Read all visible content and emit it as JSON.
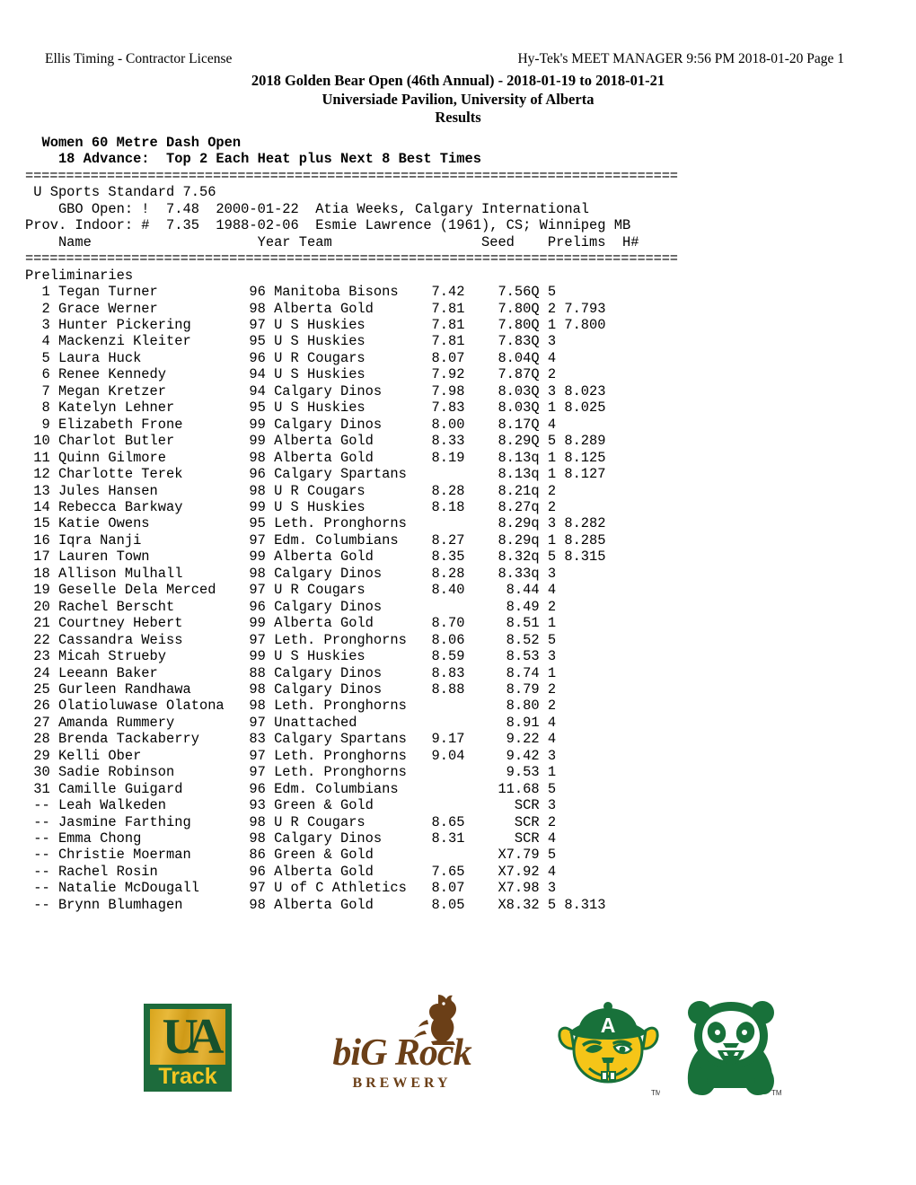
{
  "header": {
    "left": "Ellis Timing - Contractor License",
    "right": "Hy-Tek's MEET MANAGER  9:56 PM  2018-01-20  Page 1"
  },
  "title": {
    "line1": "2018 Golden Bear Open (46th Annual) - 2018-01-19 to 2018-01-21",
    "line2": "Universiade Pavilion, University of Alberta",
    "line3": "Results"
  },
  "event": {
    "name": "Women 60 Metre Dash Open",
    "advance": "18 Advance:  Top 2 Each Heat plus Next 8 Best Times"
  },
  "rules": {
    "top": "================================================================================",
    "mid": "================================================================================"
  },
  "standards": [
    "U Sports Standard 7.56",
    "   GBO Open: !  7.48  2000-01-22  Atia Weeks, Calgary International",
    "Prov. Indoor: #  7.35  1988-02-06  Esmie Lawrence (1961), CS; Winnipeg MB"
  ],
  "columns": {
    "name": "Name",
    "year": "Year",
    "team": "Team",
    "seed": "Seed",
    "prelims": "Prelims",
    "heat": "H#",
    "header_line": "    Name                    Year Team                  Seed    Prelims  H#"
  },
  "section_label": "Preliminaries",
  "results": [
    {
      "place": "1",
      "name": "Tegan Turner",
      "year": "96",
      "team": "Manitoba Bisons",
      "seed": "7.42",
      "prelims": "7.56Q",
      "heat": "5",
      "tiebreak": ""
    },
    {
      "place": "2",
      "name": "Grace Werner",
      "year": "98",
      "team": "Alberta Gold",
      "seed": "7.81",
      "prelims": "7.80Q",
      "heat": "2",
      "tiebreak": "7.793"
    },
    {
      "place": "3",
      "name": "Hunter Pickering",
      "year": "97",
      "team": "U S Huskies",
      "seed": "7.81",
      "prelims": "7.80Q",
      "heat": "1",
      "tiebreak": "7.800"
    },
    {
      "place": "4",
      "name": "Mackenzi Kleiter",
      "year": "95",
      "team": "U S Huskies",
      "seed": "7.81",
      "prelims": "7.83Q",
      "heat": "3",
      "tiebreak": ""
    },
    {
      "place": "5",
      "name": "Laura Huck",
      "year": "96",
      "team": "U R Cougars",
      "seed": "8.07",
      "prelims": "8.04Q",
      "heat": "4",
      "tiebreak": ""
    },
    {
      "place": "6",
      "name": "Renee Kennedy",
      "year": "94",
      "team": "U S Huskies",
      "seed": "7.92",
      "prelims": "7.87Q",
      "heat": "2",
      "tiebreak": ""
    },
    {
      "place": "7",
      "name": "Megan Kretzer",
      "year": "94",
      "team": "Calgary Dinos",
      "seed": "7.98",
      "prelims": "8.03Q",
      "heat": "3",
      "tiebreak": "8.023"
    },
    {
      "place": "8",
      "name": "Katelyn Lehner",
      "year": "95",
      "team": "U S Huskies",
      "seed": "7.83",
      "prelims": "8.03Q",
      "heat": "1",
      "tiebreak": "8.025"
    },
    {
      "place": "9",
      "name": "Elizabeth Frone",
      "year": "99",
      "team": "Calgary Dinos",
      "seed": "8.00",
      "prelims": "8.17Q",
      "heat": "4",
      "tiebreak": ""
    },
    {
      "place": "10",
      "name": "Charlot Butler",
      "year": "99",
      "team": "Alberta Gold",
      "seed": "8.33",
      "prelims": "8.29Q",
      "heat": "5",
      "tiebreak": "8.289"
    },
    {
      "place": "11",
      "name": "Quinn Gilmore",
      "year": "98",
      "team": "Alberta Gold",
      "seed": "8.19",
      "prelims": "8.13q",
      "heat": "1",
      "tiebreak": "8.125"
    },
    {
      "place": "12",
      "name": "Charlotte Terek",
      "year": "96",
      "team": "Calgary Spartans",
      "seed": "",
      "prelims": "8.13q",
      "heat": "1",
      "tiebreak": "8.127"
    },
    {
      "place": "13",
      "name": "Jules Hansen",
      "year": "98",
      "team": "U R Cougars",
      "seed": "8.28",
      "prelims": "8.21q",
      "heat": "2",
      "tiebreak": ""
    },
    {
      "place": "14",
      "name": "Rebecca Barkway",
      "year": "99",
      "team": "U S Huskies",
      "seed": "8.18",
      "prelims": "8.27q",
      "heat": "2",
      "tiebreak": ""
    },
    {
      "place": "15",
      "name": "Katie Owens",
      "year": "95",
      "team": "Leth. Pronghorns",
      "seed": "",
      "prelims": "8.29q",
      "heat": "3",
      "tiebreak": "8.282"
    },
    {
      "place": "16",
      "name": "Iqra Nanji",
      "year": "97",
      "team": "Edm. Columbians",
      "seed": "8.27",
      "prelims": "8.29q",
      "heat": "1",
      "tiebreak": "8.285"
    },
    {
      "place": "17",
      "name": "Lauren Town",
      "year": "99",
      "team": "Alberta Gold",
      "seed": "8.35",
      "prelims": "8.32q",
      "heat": "5",
      "tiebreak": "8.315"
    },
    {
      "place": "18",
      "name": "Allison Mulhall",
      "year": "98",
      "team": "Calgary Dinos",
      "seed": "8.28",
      "prelims": "8.33q",
      "heat": "3",
      "tiebreak": ""
    },
    {
      "place": "19",
      "name": "Geselle Dela Merced",
      "year": "97",
      "team": "U R Cougars",
      "seed": "8.40",
      "prelims": "8.44",
      "heat": "4",
      "tiebreak": ""
    },
    {
      "place": "20",
      "name": "Rachel Berscht",
      "year": "96",
      "team": "Calgary Dinos",
      "seed": "",
      "prelims": "8.49",
      "heat": "2",
      "tiebreak": ""
    },
    {
      "place": "21",
      "name": "Courtney Hebert",
      "year": "99",
      "team": "Alberta Gold",
      "seed": "8.70",
      "prelims": "8.51",
      "heat": "1",
      "tiebreak": ""
    },
    {
      "place": "22",
      "name": "Cassandra Weiss",
      "year": "97",
      "team": "Leth. Pronghorns",
      "seed": "8.06",
      "prelims": "8.52",
      "heat": "5",
      "tiebreak": ""
    },
    {
      "place": "23",
      "name": "Micah Strueby",
      "year": "99",
      "team": "U S Huskies",
      "seed": "8.59",
      "prelims": "8.53",
      "heat": "3",
      "tiebreak": ""
    },
    {
      "place": "24",
      "name": "Leeann Baker",
      "year": "88",
      "team": "Calgary Dinos",
      "seed": "8.83",
      "prelims": "8.74",
      "heat": "1",
      "tiebreak": ""
    },
    {
      "place": "25",
      "name": "Gurleen Randhawa",
      "year": "98",
      "team": "Calgary Dinos",
      "seed": "8.88",
      "prelims": "8.79",
      "heat": "2",
      "tiebreak": ""
    },
    {
      "place": "26",
      "name": "Olatioluwase Olatona",
      "year": "98",
      "team": "Leth. Pronghorns",
      "seed": "",
      "prelims": "8.80",
      "heat": "2",
      "tiebreak": ""
    },
    {
      "place": "27",
      "name": "Amanda Rummery",
      "year": "97",
      "team": "Unattached",
      "seed": "",
      "prelims": "8.91",
      "heat": "4",
      "tiebreak": ""
    },
    {
      "place": "28",
      "name": "Brenda Tackaberry",
      "year": "83",
      "team": "Calgary Spartans",
      "seed": "9.17",
      "prelims": "9.22",
      "heat": "4",
      "tiebreak": ""
    },
    {
      "place": "29",
      "name": "Kelli Ober",
      "year": "97",
      "team": "Leth. Pronghorns",
      "seed": "9.04",
      "prelims": "9.42",
      "heat": "3",
      "tiebreak": ""
    },
    {
      "place": "30",
      "name": "Sadie Robinson",
      "year": "97",
      "team": "Leth. Pronghorns",
      "seed": "",
      "prelims": "9.53",
      "heat": "1",
      "tiebreak": ""
    },
    {
      "place": "31",
      "name": "Camille Guigard",
      "year": "96",
      "team": "Edm. Columbians",
      "seed": "",
      "prelims": "11.68",
      "heat": "5",
      "tiebreak": ""
    },
    {
      "place": "--",
      "name": "Leah Walkeden",
      "year": "93",
      "team": "Green & Gold",
      "seed": "",
      "prelims": "SCR",
      "heat": "3",
      "tiebreak": ""
    },
    {
      "place": "--",
      "name": "Jasmine Farthing",
      "year": "98",
      "team": "U R Cougars",
      "seed": "8.65",
      "prelims": "SCR",
      "heat": "2",
      "tiebreak": ""
    },
    {
      "place": "--",
      "name": "Emma Chong",
      "year": "98",
      "team": "Calgary Dinos",
      "seed": "8.31",
      "prelims": "SCR",
      "heat": "4",
      "tiebreak": ""
    },
    {
      "place": "--",
      "name": "Christie Moerman",
      "year": "86",
      "team": "Green & Gold",
      "seed": "",
      "prelims": "X7.79",
      "heat": "5",
      "tiebreak": ""
    },
    {
      "place": "--",
      "name": "Rachel Rosin",
      "year": "96",
      "team": "Alberta Gold",
      "seed": "7.65",
      "prelims": "X7.92",
      "heat": "4",
      "tiebreak": ""
    },
    {
      "place": "--",
      "name": "Natalie McDougall",
      "year": "97",
      "team": "U of C Athletics",
      "seed": "8.07",
      "prelims": "X7.98",
      "heat": "3",
      "tiebreak": ""
    },
    {
      "place": "--",
      "name": "Brynn Blumhagen",
      "year": "98",
      "team": "Alberta Gold",
      "seed": "8.05",
      "prelims": "X8.32",
      "heat": "5",
      "tiebreak": "8.313"
    }
  ],
  "logos": {
    "ua_track": {
      "mark": "UA",
      "word": "Track",
      "green": "#1d6b3c",
      "gold": "#d9a51d",
      "word_color": "#f3c623"
    },
    "big_rock": {
      "name": "biG Rock",
      "sub": "BREWERY",
      "color": "#6b3f17"
    },
    "golden_bear": {
      "letter": "A",
      "gold": "#f5c518",
      "green": "#18713a",
      "tm": "TM"
    },
    "panda": {
      "green": "#18713a",
      "tm": "TM"
    }
  }
}
